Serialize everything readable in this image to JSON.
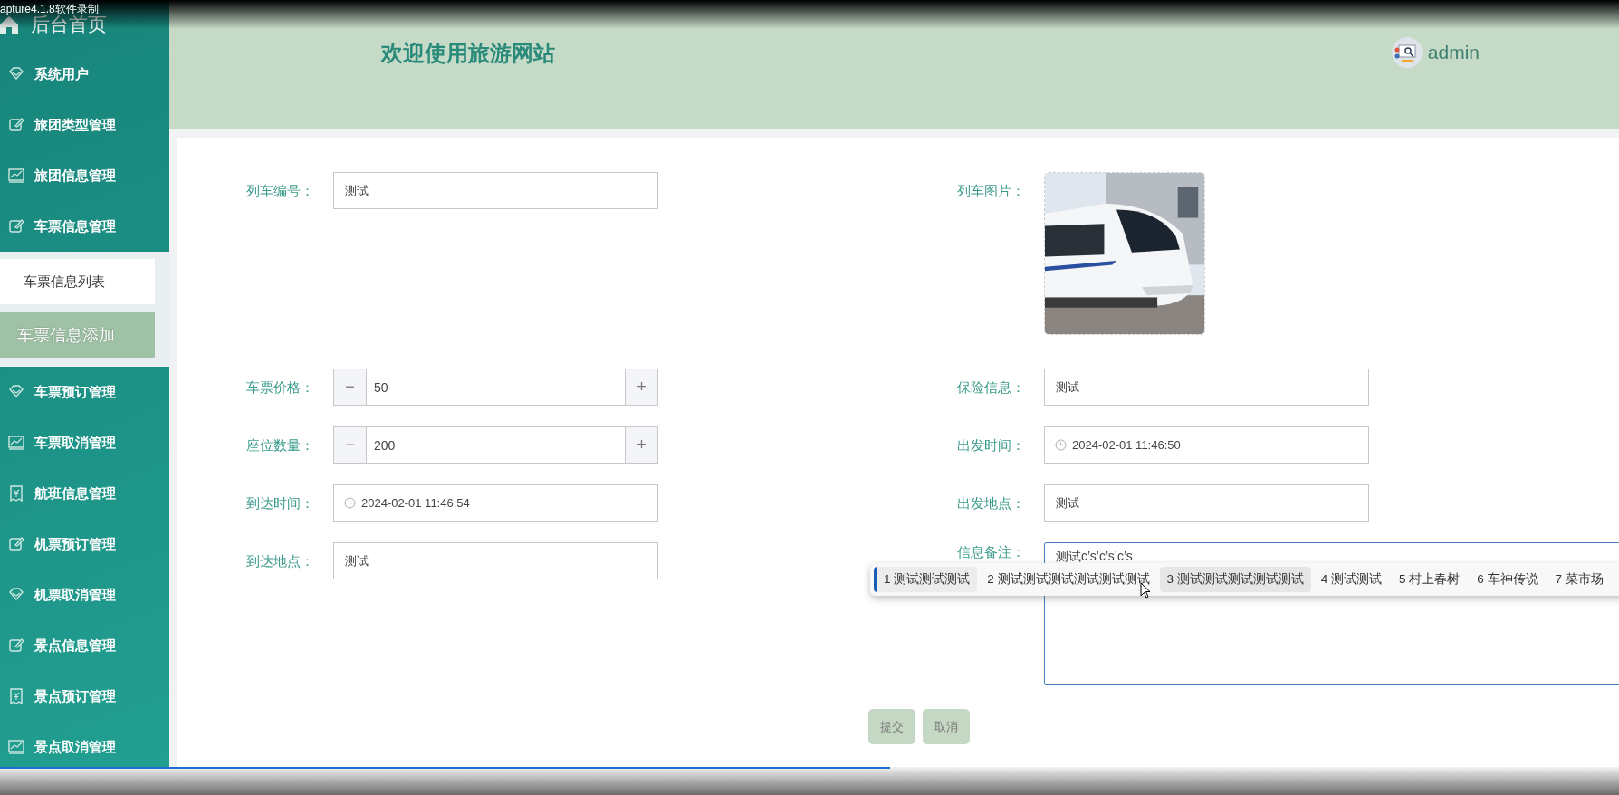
{
  "recorder_label": "apture4.1.8软件录制",
  "sidebar": {
    "home": "后台首页",
    "items": [
      {
        "label": "系统用户",
        "kind": "diamond"
      },
      {
        "label": "旅团类型管理",
        "kind": "edit"
      },
      {
        "label": "旅团信息管理",
        "kind": "chart"
      },
      {
        "label": "车票信息管理",
        "kind": "edit",
        "expanded": true,
        "children": [
          {
            "label": "车票信息列表",
            "selected": false
          },
          {
            "label": "车票信息添加",
            "selected": true
          }
        ]
      },
      {
        "label": "车票预订管理",
        "kind": "diamond"
      },
      {
        "label": "车票取消管理",
        "kind": "chart"
      },
      {
        "label": "航班信息管理",
        "kind": "ticket"
      },
      {
        "label": "机票预订管理",
        "kind": "edit"
      },
      {
        "label": "机票取消管理",
        "kind": "diamond"
      },
      {
        "label": "景点信息管理",
        "kind": "edit"
      },
      {
        "label": "景点预订管理",
        "kind": "ticket"
      },
      {
        "label": "景点取消管理",
        "kind": "chart"
      }
    ]
  },
  "header": {
    "title": "欢迎使用旅游网站",
    "user": "admin"
  },
  "form": {
    "rows": [
      [
        {
          "label": "列车编号：",
          "kind": "text",
          "value": "测试"
        },
        {
          "label": "列车图片：",
          "kind": "picture"
        }
      ],
      [
        {
          "label": "车票价格：",
          "kind": "number",
          "value": "50",
          "minus": "−",
          "plus": "+"
        },
        {
          "label": "保险信息：",
          "kind": "text",
          "value": "测试"
        }
      ],
      [
        {
          "label": "座位数量：",
          "kind": "number",
          "value": "200",
          "minus": "−",
          "plus": "+"
        },
        {
          "label": "出发时间：",
          "kind": "date",
          "value": "2024-02-01 11:46:50"
        }
      ],
      [
        {
          "label": "到达时间：",
          "kind": "date",
          "value": "2024-02-01 11:46:54"
        },
        {
          "label": "出发地点：",
          "kind": "text",
          "value": "测试"
        }
      ],
      [
        {
          "label": "到达地点：",
          "kind": "text",
          "value": "测试"
        },
        {
          "label": "信息备注：",
          "kind": "textarea",
          "value": "测试c’s’c’s’c’s"
        }
      ]
    ],
    "buttons": [
      "提交",
      "取消"
    ]
  },
  "ime": {
    "candidates": [
      {
        "label": "1 测试测试测试",
        "selected": true,
        "hovered": false
      },
      {
        "label": "2 测试测试测试测试测试测试",
        "selected": false,
        "hovered": false
      },
      {
        "label": "3 测试测试测试测试测试",
        "selected": false,
        "hovered": true
      },
      {
        "label": "4 测试测试",
        "selected": false,
        "hovered": false
      },
      {
        "label": "5 村上春树",
        "selected": false,
        "hovered": false
      },
      {
        "label": "6 车神传说",
        "selected": false,
        "hovered": false
      },
      {
        "label": "7 菜市场",
        "selected": false,
        "hovered": false
      }
    ]
  },
  "player": {
    "level": 0.55
  }
}
